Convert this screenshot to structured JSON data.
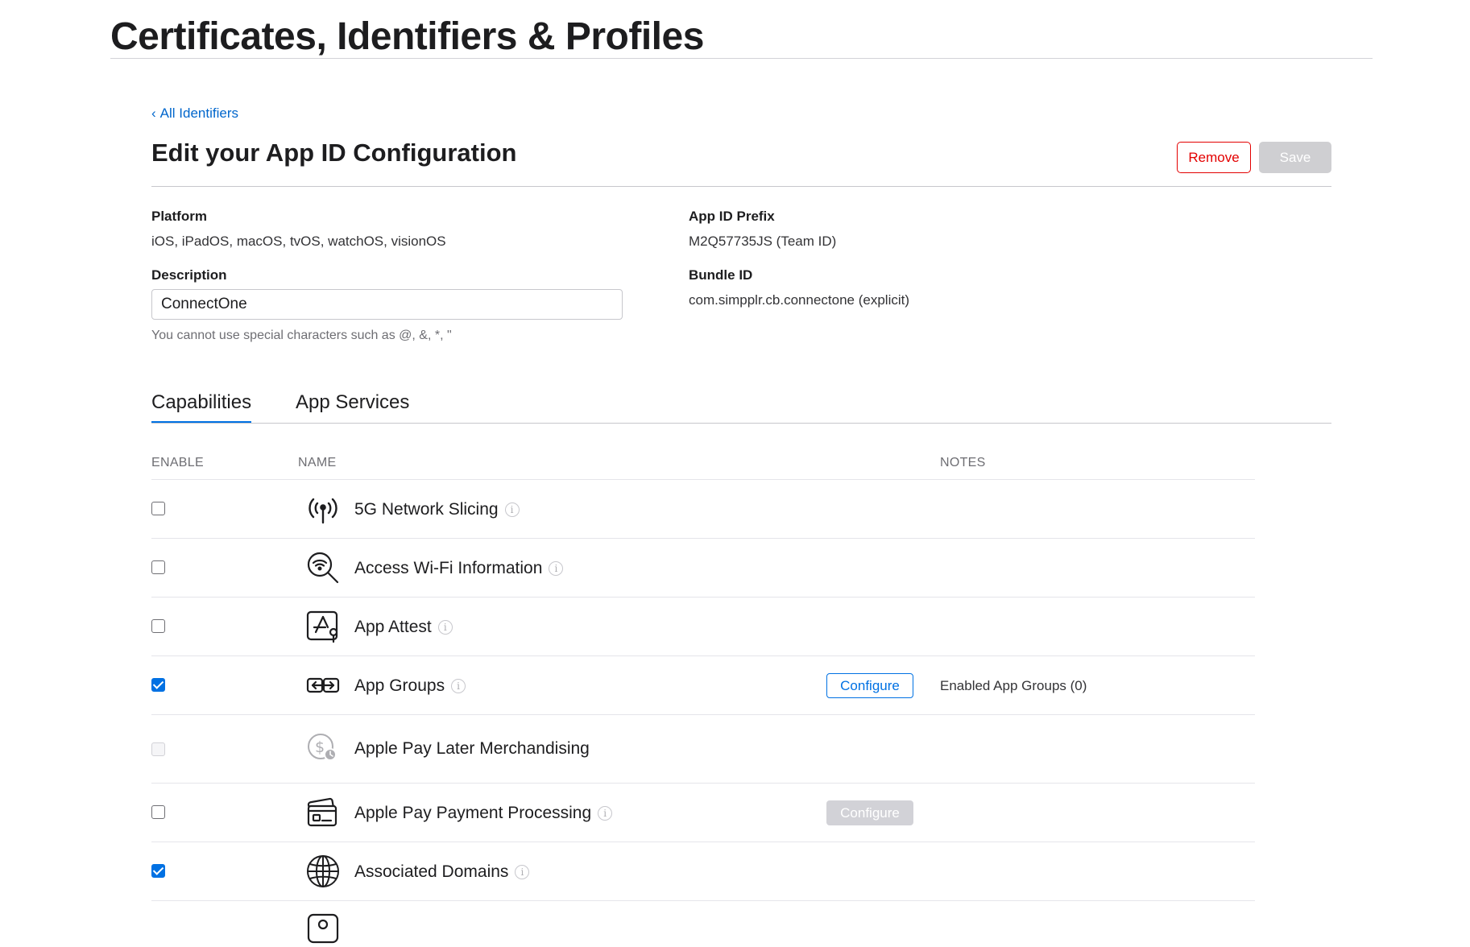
{
  "header": {
    "title": "Certificates, Identifiers & Profiles"
  },
  "nav": {
    "back_chevron": "‹",
    "back_label": "All Identifiers"
  },
  "section": {
    "title": "Edit your App ID Configuration",
    "remove_label": "Remove",
    "save_label": "Save"
  },
  "fields": {
    "platform_label": "Platform",
    "platform_value": "iOS, iPadOS, macOS, tvOS, watchOS, visionOS",
    "description_label": "Description",
    "description_value": "ConnectOne",
    "description_hint": "You cannot use special characters such as @, &, *, \"",
    "prefix_label": "App ID Prefix",
    "prefix_value": "M2Q57735JS (Team ID)",
    "bundle_label": "Bundle ID",
    "bundle_value": "com.simpplr.cb.connectone (explicit)"
  },
  "tabs": [
    {
      "label": "Capabilities",
      "selected": true
    },
    {
      "label": "App Services",
      "selected": false
    }
  ],
  "table": {
    "columns": {
      "enable": "ENABLE",
      "name": "NAME",
      "notes": "NOTES"
    },
    "rows": [
      {
        "name": "5G Network Slicing",
        "icon": "antenna-icon",
        "checked": false,
        "disabled": false,
        "info": "i",
        "configure": "",
        "note": ""
      },
      {
        "name": "Access Wi-Fi Information",
        "icon": "wifi-search-icon",
        "checked": false,
        "disabled": false,
        "info": "i",
        "configure": "",
        "note": ""
      },
      {
        "name": "App Attest",
        "icon": "app-attest-icon",
        "checked": false,
        "disabled": false,
        "info": "i",
        "configure": "",
        "note": ""
      },
      {
        "name": "App Groups",
        "icon": "app-groups-icon",
        "checked": true,
        "disabled": false,
        "info": "i",
        "configure": "Configure",
        "configure_active": true,
        "note": "Enabled App Groups (0)"
      },
      {
        "name": "Apple Pay Later Merchandising",
        "icon": "apple-pay-later-icon",
        "checked": false,
        "disabled": true,
        "info": "",
        "configure": "",
        "note": ""
      },
      {
        "name": "Apple Pay Payment Processing",
        "icon": "apple-pay-cards-icon",
        "checked": false,
        "disabled": false,
        "info": "i",
        "configure": "Configure",
        "configure_active": false,
        "note": ""
      },
      {
        "name": "Associated Domains",
        "icon": "globe-icon",
        "checked": true,
        "disabled": false,
        "info": "i",
        "configure": "",
        "note": ""
      }
    ]
  },
  "colors": {
    "accent": "#0071e3",
    "link": "#0066cc",
    "danger": "#e30000",
    "disabled": "#cfcfd2"
  }
}
